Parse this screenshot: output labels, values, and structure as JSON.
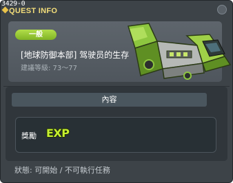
{
  "window": {
    "quest_id": "3429-0",
    "title": "QUEST INFO"
  },
  "header": {
    "category_badge": "一般",
    "quest_name": "[地球防御本部] 驾驶员的生存",
    "recommended_level": "建議等級: 73～77"
  },
  "content": {
    "tab_label": "內容",
    "reward_label": "獎勵",
    "reward_icon": "exp-icon",
    "reward_icon_text": "EXP"
  },
  "footer": {
    "status": "狀態: 可開始 / 不可執行任務"
  },
  "colors": {
    "title": "#f4de7a",
    "badge": "#9acb35",
    "panel": "#3d4348",
    "exp": "#c6ef2f"
  }
}
